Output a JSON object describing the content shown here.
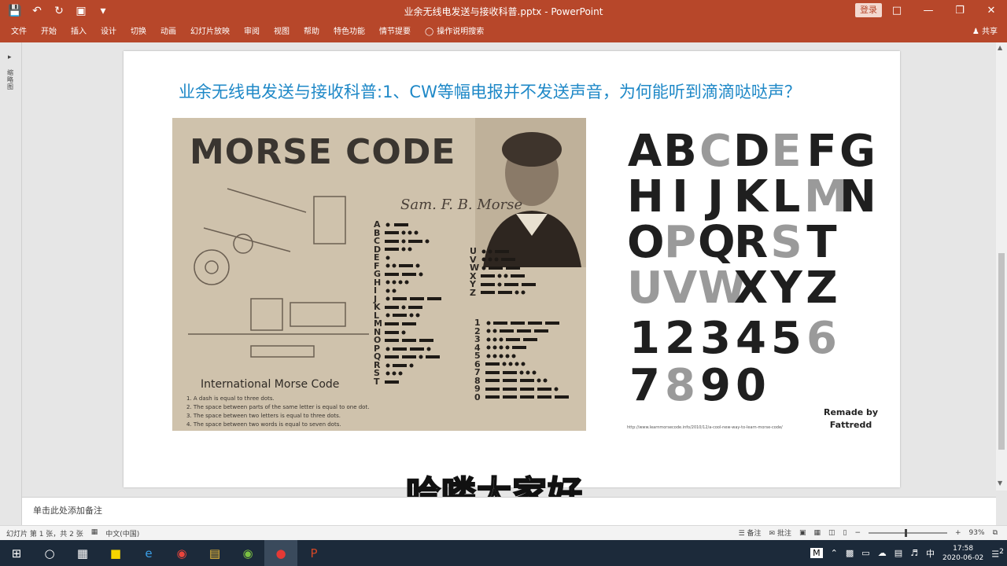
{
  "titlebar": {
    "doc_title": "业余无线电发送与接收科普.pptx - PowerPoint",
    "login": "登录",
    "qat_icons": [
      "save-icon",
      "undo-icon",
      "redo-icon",
      "present-icon",
      "customize-icon"
    ]
  },
  "ribbon": {
    "tabs": [
      "文件",
      "开始",
      "插入",
      "设计",
      "切换",
      "动画",
      "幻灯片放映",
      "审阅",
      "视图",
      "帮助",
      "特色功能",
      "情节提要"
    ],
    "tellme": "操作说明搜索",
    "share": "共享"
  },
  "slide": {
    "title": "业余无线电发送与接收科普:1、CW等幅电报并不发送声音，为何能听到滴滴哒哒声？",
    "poster": {
      "title": "MORSE CODE",
      "signature": "Sam. F. B. Morse",
      "intl_title": "International Morse Code",
      "rules": [
        "1. A dash is equal to three dots.",
        "2. The space between parts of the same letter is equal to one dot.",
        "3. The space between two letters is equal to three dots.",
        "4. The space between two words is equal to seven dots."
      ],
      "letters_a_t": [
        "A",
        "B",
        "C",
        "D",
        "E",
        "F",
        "G",
        "H",
        "I",
        "J",
        "K",
        "L",
        "M",
        "N",
        "O",
        "P",
        "Q",
        "R",
        "S",
        "T"
      ],
      "letters_u_z": [
        "U",
        "V",
        "W",
        "X",
        "Y",
        "Z"
      ],
      "digits": [
        "1",
        "2",
        "3",
        "4",
        "5",
        "6",
        "7",
        "8",
        "9",
        "0"
      ]
    },
    "chart": {
      "rows": [
        [
          "A",
          "B",
          "C",
          "D",
          "E",
          "F",
          "G"
        ],
        [
          "H",
          "I",
          "J",
          "K",
          "L",
          "M",
          "N"
        ],
        [
          "O",
          "P",
          "Q",
          "R",
          "S",
          "T"
        ],
        [
          "U",
          "V",
          "W",
          "X",
          "Y",
          "Z"
        ],
        [
          "1",
          "2",
          "3",
          "4",
          "5",
          "6"
        ],
        [
          "7",
          "8",
          "9",
          "0"
        ]
      ],
      "remade_line1": "Remade by",
      "remade_line2": "Fattredd",
      "url": "http://www.learnmorsecode.info/2010/12/a-cool-new-way-to-learn-morse-code/"
    }
  },
  "subtitle": "哈喽大家好",
  "notes_placeholder": "单击此处添加备注",
  "status": {
    "slide_count": "幻灯片 第 1 张，共 2 张",
    "language": "中文(中国)",
    "notes": "备注",
    "comments": "批注",
    "zoom": "93%"
  },
  "taskbar": {
    "time": "17:58",
    "date": "2020-06-02",
    "notification_count": "2"
  }
}
